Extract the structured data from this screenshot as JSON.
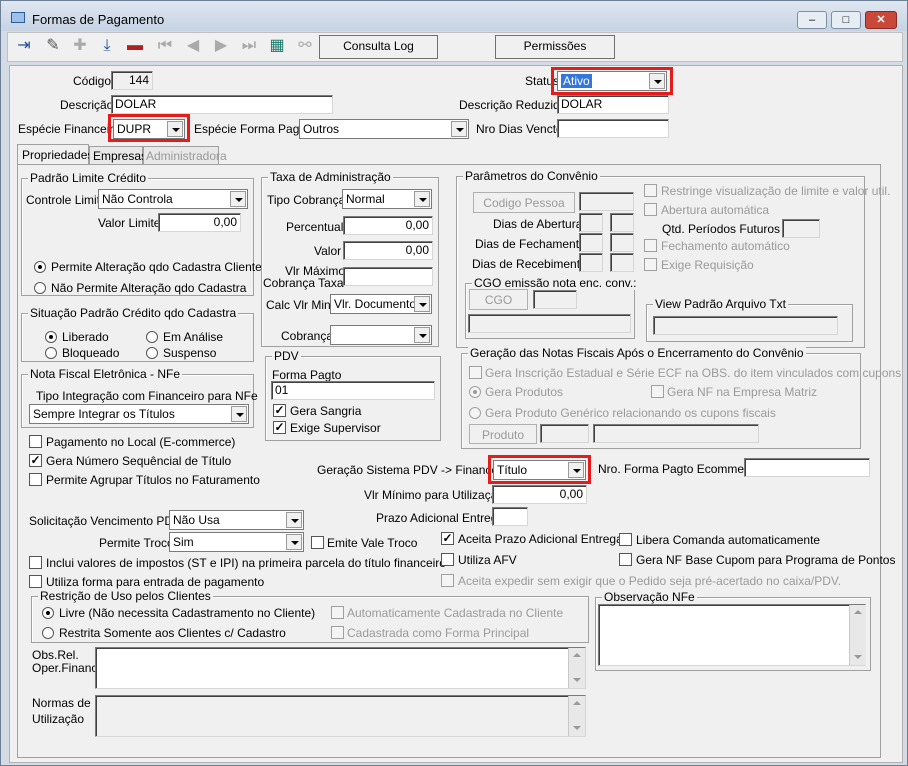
{
  "window": {
    "title": "Formas de Pagamento",
    "minimize": "–",
    "maximize": "□",
    "close": "✕"
  },
  "toolbar": {
    "consulta_log": "Consulta Log",
    "permissoes": "Permissões"
  },
  "header": {
    "codigo_label": "Código",
    "codigo_value": "144",
    "status_label": "Status",
    "status_value": "Ativo",
    "descricao_label": "Descrição",
    "descricao_value": "DOLAR",
    "descricao_reduzida_label": "Descrição Reduzida",
    "descricao_reduzida_value": "DOLAR",
    "especie_financeira_label": "Espécie Financeira",
    "especie_financeira_value": "DUPR",
    "especie_forma_pagto_label": "Espécie Forma Pagto",
    "especie_forma_pagto_value": "Outros",
    "nro_dias_vencto_label": "Nro Dias Vencto",
    "nro_dias_vencto_value": ""
  },
  "tabs": [
    "Propriedades",
    "Empresas",
    "Administradora"
  ],
  "padrao_limite": {
    "title": "Padrão Limite Crédito",
    "controle_label": "Controle Limite",
    "controle_value": "Não Controla",
    "valor_label": "Valor Limite",
    "valor_value": "0,00",
    "opt1": "Permite Alteração qdo Cadastra Cliente",
    "opt2": "Não Permite Alteração qdo Cadastra"
  },
  "situacao": {
    "title": "Situação Padrão Crédito qdo Cadastra",
    "liberado": "Liberado",
    "em_analise": "Em Análise",
    "bloqueado": "Bloqueado",
    "suspenso": "Suspenso"
  },
  "nfe": {
    "title": "Nota Fiscal Eletrônica - NFe",
    "tipo_label": "Tipo Integração com Financeiro para NFe",
    "tipo_value": "Sempre Integrar os Títulos"
  },
  "checks_left": {
    "pagamento_local": "Pagamento no Local (E-commerce)",
    "gera_numero": "Gera Número Sequêncial de Título",
    "permite_agrupar": "Permite Agrupar Títulos no Faturamento"
  },
  "taxa": {
    "title": "Taxa de Administração",
    "tipo_cobranca_label": "Tipo Cobrança",
    "tipo_cobranca_value": "Normal",
    "percentual_label": "Percentual",
    "percentual_value": "0,00",
    "valor_label": "Valor",
    "valor_value": "0,00",
    "vlr_max_label1": "Vlr Máximo",
    "vlr_max_label2": "Cobrança Taxa",
    "vlr_max_value": "",
    "calc_label": "Calc Vlr Min",
    "calc_value": "Vlr. Documento",
    "cobranca_label": "Cobrança",
    "cobranca_value": ""
  },
  "pdv": {
    "title": "PDV",
    "forma_pagto_label": "Forma Pagto",
    "forma_pagto_value": "01",
    "gera_sangria": "Gera Sangria",
    "exige_supervisor": "Exige Supervisor"
  },
  "convenio": {
    "title": "Parâmetros do Convênio",
    "codigo_pessoa": "Codigo Pessoa",
    "dias_abertura": "Dias de Abertura",
    "dias_fechamento": "Dias de Fechamento",
    "dias_recebimento": "Dias de Recebimento",
    "restringe": "Restringe visualização de limite e valor util.",
    "abertura_auto": "Abertura automática",
    "qtd_periodos": "Qtd. Períodos Futuros",
    "fechamento_auto": "Fechamento automático",
    "exige_requisicao": "Exige Requisição",
    "cgo_title": "CGO emissão nota enc. conv.:",
    "cgo_button": "CGO",
    "view_title": "View Padrão Arquivo Txt"
  },
  "geracao": {
    "title": "Geração das Notas Fiscais Após o Encerramento do Convênio",
    "gera_inscricao": "Gera Inscrição Estadual e Série ECF na OBS. do item vinculados com cupons",
    "gera_produtos": "Gera Produtos",
    "gera_nf_matriz": "Gera NF na Empresa Matriz",
    "gera_generico": "Gera Produto Genérico relacionando os cupons fiscais",
    "produto_button": "Produto"
  },
  "sistema": {
    "geracao_pdv_label": "Geração Sistema PDV -> Financeiro",
    "geracao_pdv_value": "Título",
    "nro_ecommerce_label": "Nro. Forma Pagto Ecommerce",
    "nro_ecommerce_value": "",
    "vlr_minimo_label": "Vlr Mínimo para Utilização",
    "vlr_minimo_value": "0,00",
    "prazo_label": "Prazo Adicional Entrega",
    "prazo_value": ""
  },
  "lower": {
    "solicitacao_label": "Solicitação Vencimento PDV",
    "solicitacao_value": "Não Usa",
    "permite_troco_label": "Permite Troco",
    "permite_troco_value": "Sim",
    "emite_vale": "Emite Vale Troco",
    "inclui_impostos": "Inclui valores de impostos (ST e IPI) na primeira parcela do título financeiro",
    "utiliza_forma": "Utiliza forma para entrada de pagamento",
    "aceita_prazo": "Aceita Prazo Adicional Entrega",
    "libera_comanda": "Libera Comanda automaticamente",
    "utiliza_afv": "Utiliza AFV",
    "gera_nf_base": "Gera NF Base Cupom para Programa de Pontos",
    "aceita_expedir": "Aceita expedir sem exigir que o Pedido seja pré-acertado no caixa/PDV."
  },
  "restricao": {
    "title": "Restrição de Uso pelos Clientes",
    "livre": "Livre (Não necessita Cadastramento no Cliente)",
    "restrita": "Restrita Somente aos Clientes c/ Cadastro",
    "auto_cadastrada": "Automaticamente Cadastrada no Cliente",
    "cadastrada_principal": "Cadastrada como Forma Principal"
  },
  "obs_nfe": {
    "title": "Observação NFe"
  },
  "obs_rel": {
    "label1": "Obs.Rel.",
    "label2": "Oper.Financ."
  },
  "normas": {
    "label1": "Normas de",
    "label2": "Utilização"
  }
}
